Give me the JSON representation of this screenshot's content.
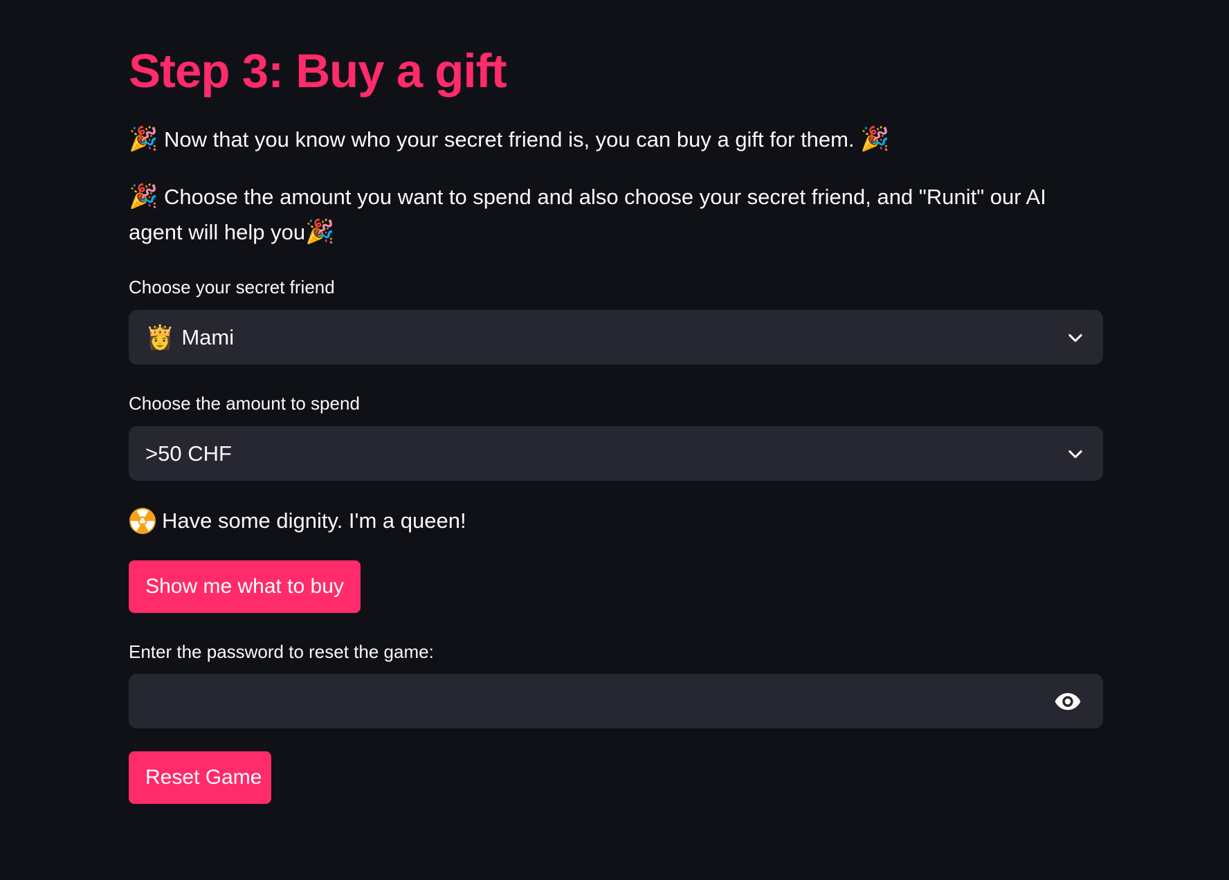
{
  "page": {
    "title": "Step 3: Buy a gift",
    "intro_emoji": "🎉",
    "intro_text": " Now that you know who your secret friend is, you can buy a gift for them. ",
    "instructions_text": " Choose the amount you want to spend and also choose your secret friend, and \"Runit\" our AI agent will help you"
  },
  "friend_select": {
    "label": "Choose your secret friend",
    "emoji": "👸",
    "value": "Mami",
    "icon": "chevron-down-icon"
  },
  "amount_select": {
    "label": "Choose the amount to spend",
    "value": ">50 CHF",
    "icon": "chevron-down-icon"
  },
  "warning": {
    "icon": "radioactive-icon",
    "text": "Have some dignity. I'm a queen!"
  },
  "buttons": {
    "show_label": "Show me what to buy",
    "reset_label": "Reset Game"
  },
  "password": {
    "label": "Enter the password to reset the game:",
    "value": "",
    "icon": "eye-icon"
  },
  "colors": {
    "background": "#0f1117",
    "accent": "#ff2b6a",
    "input_bg": "#262730",
    "text": "#fafafa"
  }
}
